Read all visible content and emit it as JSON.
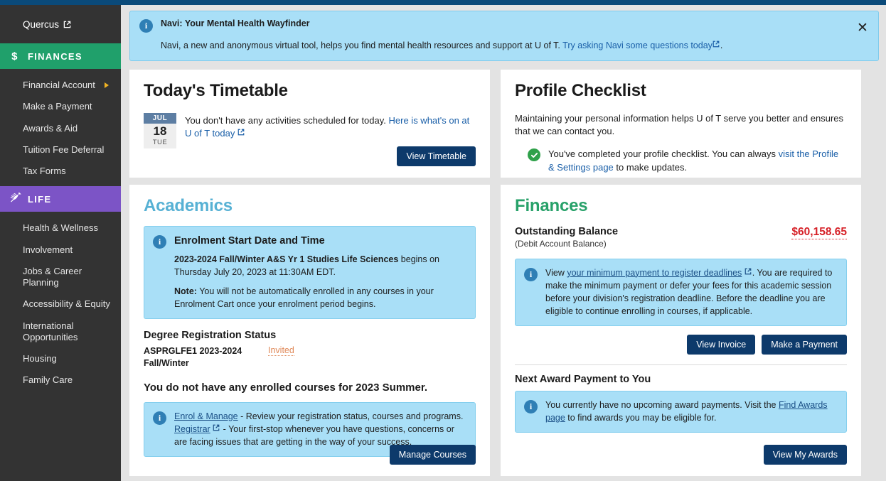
{
  "sidebar": {
    "quercus": {
      "label": "Quercus",
      "icon": "external-link-icon"
    },
    "sections": [
      {
        "header": "FINANCES",
        "icon": "dollar-icon",
        "color": "#20a06b",
        "items": [
          {
            "label": "Financial Account",
            "has_caret": true
          },
          {
            "label": "Make a Payment",
            "has_caret": false
          },
          {
            "label": "Awards & Aid",
            "has_caret": false
          },
          {
            "label": "Tuition Fee Deferral",
            "has_caret": false
          },
          {
            "label": "Tax Forms",
            "has_caret": false
          }
        ]
      },
      {
        "header": "LIFE",
        "icon": "leaf-icon",
        "color": "#7c54c6",
        "items": [
          {
            "label": "Health & Wellness",
            "has_caret": false
          },
          {
            "label": "Involvement",
            "has_caret": false
          },
          {
            "label": "Jobs & Career Planning",
            "has_caret": false
          },
          {
            "label": "Accessibility & Equity",
            "has_caret": false
          },
          {
            "label": "International Opportunities",
            "has_caret": false
          },
          {
            "label": "Housing",
            "has_caret": false
          },
          {
            "label": "Family Care",
            "has_caret": false
          }
        ]
      }
    ]
  },
  "banner": {
    "title": "Navi: Your Mental Health Wayfinder",
    "body_before": "Navi, a new and anonymous virtual tool, helps you find mental health resources and support at U of T. ",
    "link": "Try asking Navi some questions today",
    "body_after": ".",
    "close_label": "✕"
  },
  "timetable": {
    "title": "Today's Timetable",
    "date": {
      "month": "JUL",
      "day": "18",
      "weekday": "TUE"
    },
    "text_before": "You don't have any activities scheduled for today. ",
    "link": "Here is what's on at U of T today",
    "button": "View Timetable"
  },
  "profile": {
    "title": "Profile Checklist",
    "intro": "Maintaining your personal information helps U of T serve you better and ensures that we can contact you.",
    "status_before": "You've completed your profile checklist. You can always ",
    "status_link": "visit the Profile & Settings page",
    "status_after": " to make updates."
  },
  "academics": {
    "title": "Academics",
    "enrolment": {
      "title": "Enrolment Start Date and Time",
      "line_bold": "2023-2024 Fall/Winter A&S Yr 1 Studies Life Sciences",
      "line_rest": " begins on Thursday July 20, 2023 at 11:30AM EDT.",
      "note_label": "Note:",
      "note_text": " You will not be automatically enrolled in any courses in your Enrolment Cart once your enrolment period begins."
    },
    "registration_heading": "Degree Registration Status",
    "program_code": "ASPRGLFE1 2023-2024",
    "program_term": "Fall/Winter",
    "program_status": "Invited",
    "no_courses": "You do not have any enrolled courses for 2023 Summer.",
    "help": {
      "link1": "Enrol & Manage",
      "line1": " - Review your registration status, courses and programs.",
      "link2": "Registrar",
      "line2": " - Your first-stop whenever you have questions, concerns or are facing issues that are getting in the way of your success."
    },
    "button": "Manage Courses"
  },
  "finances": {
    "title": "Finances",
    "balance_label": "Outstanding Balance",
    "balance_sub": "(Debit Account Balance)",
    "balance_amount": "$60,158.65",
    "info": {
      "before": "View ",
      "link": "your minimum payment to register deadlines",
      "after": ". You are required to make the minimum payment or defer your fees for this academic session before your division's registration deadline. Before the deadline you are eligible to continue enrolling in courses, if applicable."
    },
    "buttons": {
      "invoice": "View Invoice",
      "payment": "Make a Payment"
    },
    "awards_heading": "Next Award Payment to You",
    "awards_info": {
      "before": "You currently have no upcoming award payments. Visit the ",
      "link": "Find Awards page",
      "after": " to find awards you may be eligible for."
    },
    "awards_button": "View My Awards"
  },
  "colors": {
    "topbar": "#0a4a7a",
    "sidebar": "#333333",
    "finances_green": "#20a06b",
    "life_purple": "#7c54c6",
    "button_navy": "#0d3a6b",
    "info_blue": "#a9dff7",
    "balance_red": "#d62027",
    "status_orange": "#e08a5a",
    "academics_title": "#57b1d4",
    "finances_title": "#27a169"
  }
}
